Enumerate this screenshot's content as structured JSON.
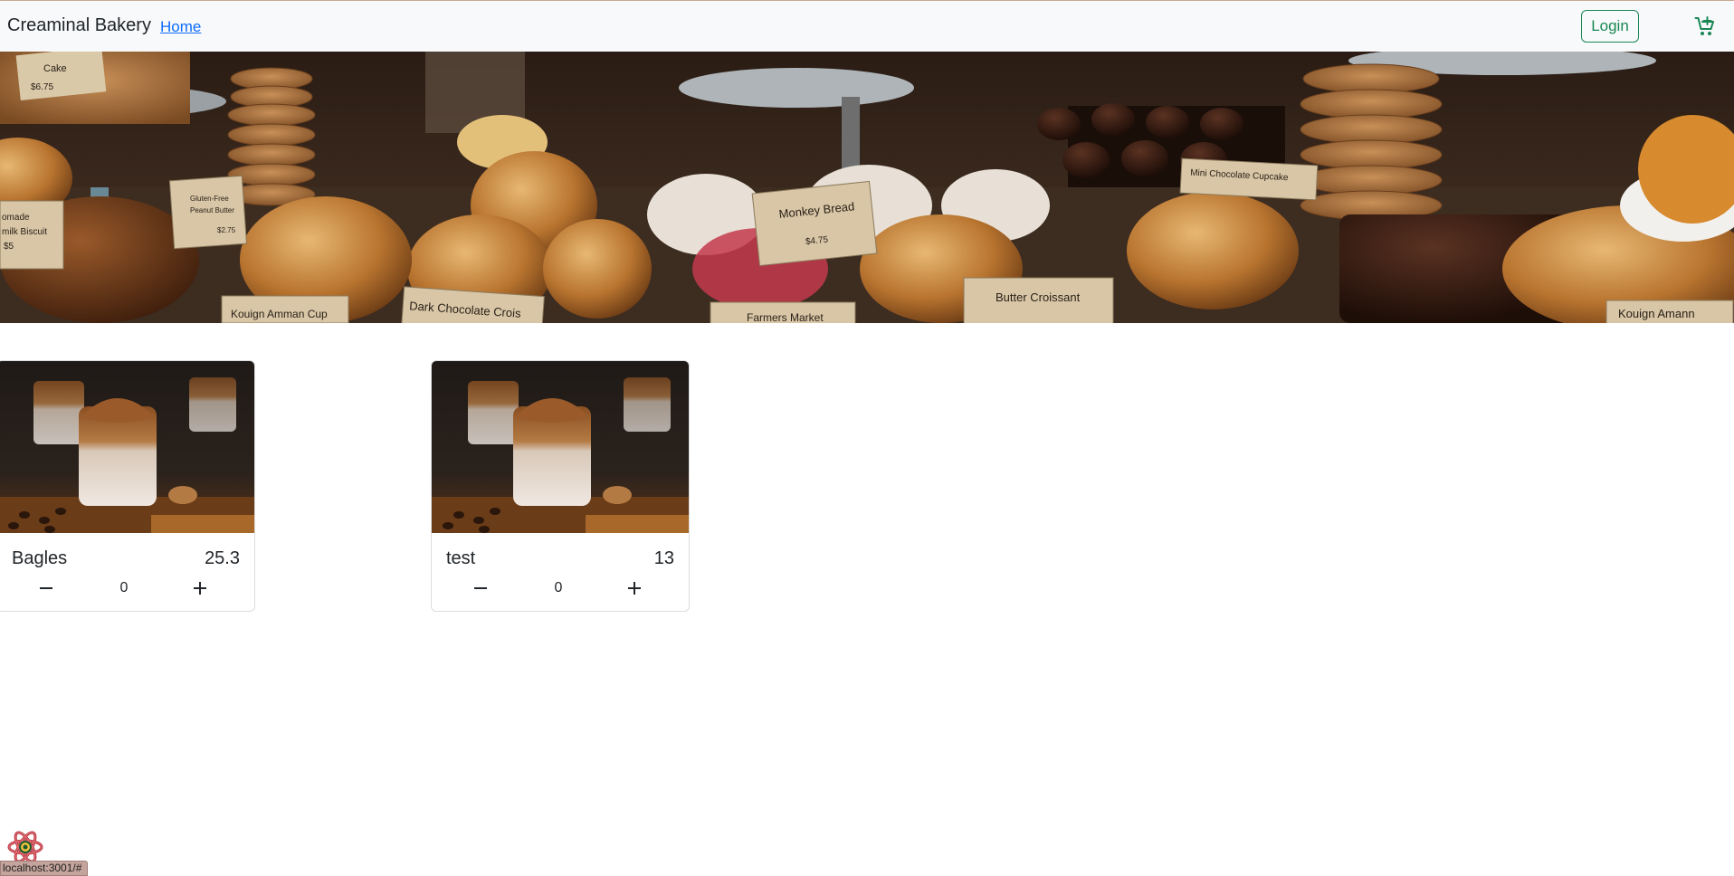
{
  "navbar": {
    "brand": "Creaminal Bakery",
    "home_link": "Home",
    "login_label": "Login",
    "cart_icon": "cart-plus-icon"
  },
  "hero": {
    "labels": [
      "Cake",
      "$6.75",
      "Gluten Free Peanut Butter",
      "$2.75",
      "Monkey Bread",
      "$4.75",
      "Mini Chocolate Cupcake",
      "Kouign Amman Cup",
      "Dark Chocolate Croissant",
      "Farmers Market",
      "Butter Croissant",
      "Kouign Amann",
      "omade",
      "milk Biscuit",
      "$5"
    ]
  },
  "products": [
    {
      "name": "Bagles",
      "price": "25.3",
      "quantity": "0"
    },
    {
      "name": "test",
      "price": "13",
      "quantity": "0"
    }
  ],
  "status_bar": {
    "url": "localhost:3001/#"
  },
  "colors": {
    "accent": "#198754",
    "link": "#0d6efd",
    "navbar_bg": "#f8f9fa"
  }
}
